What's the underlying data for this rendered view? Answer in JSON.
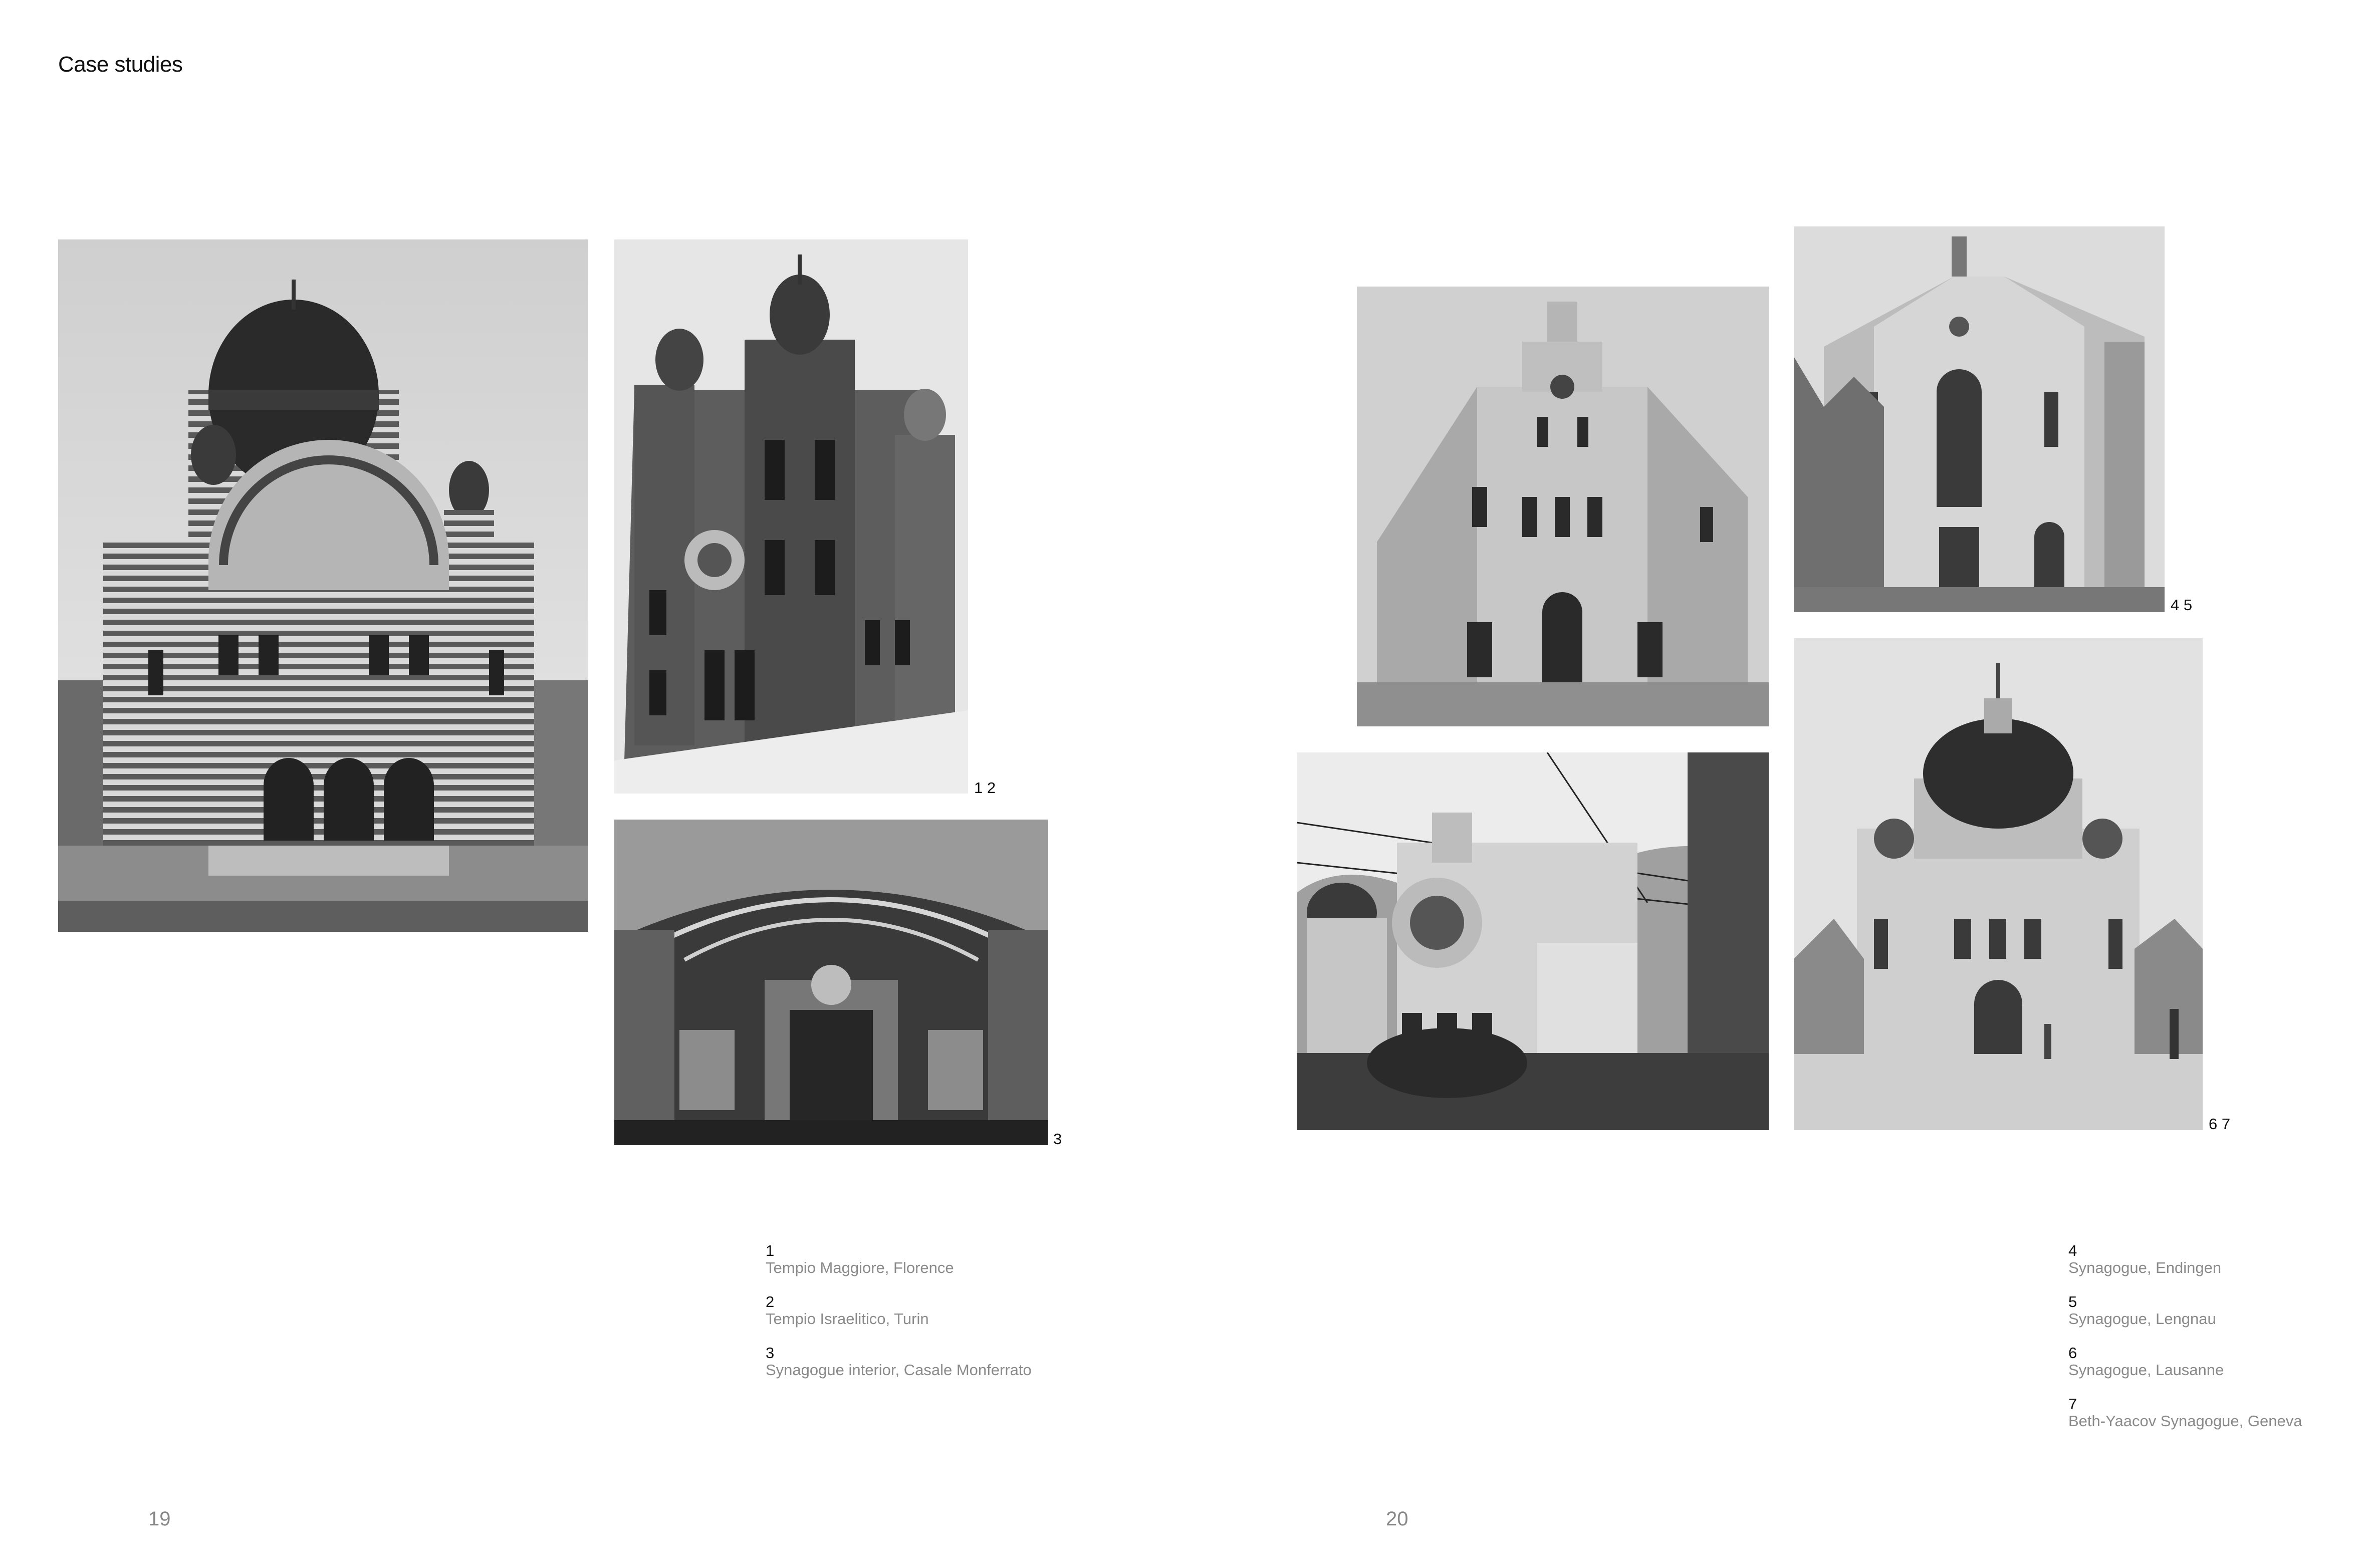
{
  "section_title": "Case studies",
  "figure_markers": {
    "first_pair": "1 2",
    "third": "3",
    "second_pair": "4 5",
    "last_pair": "6 7"
  },
  "captions_left": [
    {
      "number": "1",
      "text": "Tempio Maggiore, Florence"
    },
    {
      "number": "2",
      "text": "Tempio Israelitico, Turin"
    },
    {
      "number": "3",
      "text": "Synagogue interior, Casale Monferrato"
    }
  ],
  "captions_right": [
    {
      "number": "4",
      "text": "Synagogue, Endingen"
    },
    {
      "number": "5",
      "text": "Synagogue, Lengnau"
    },
    {
      "number": "6",
      "text": "Synagogue, Lausanne"
    },
    {
      "number": "7",
      "text": "Beth-Yaacov Synagogue, Geneva"
    }
  ],
  "page_numbers": {
    "left": "19",
    "right": "20"
  }
}
